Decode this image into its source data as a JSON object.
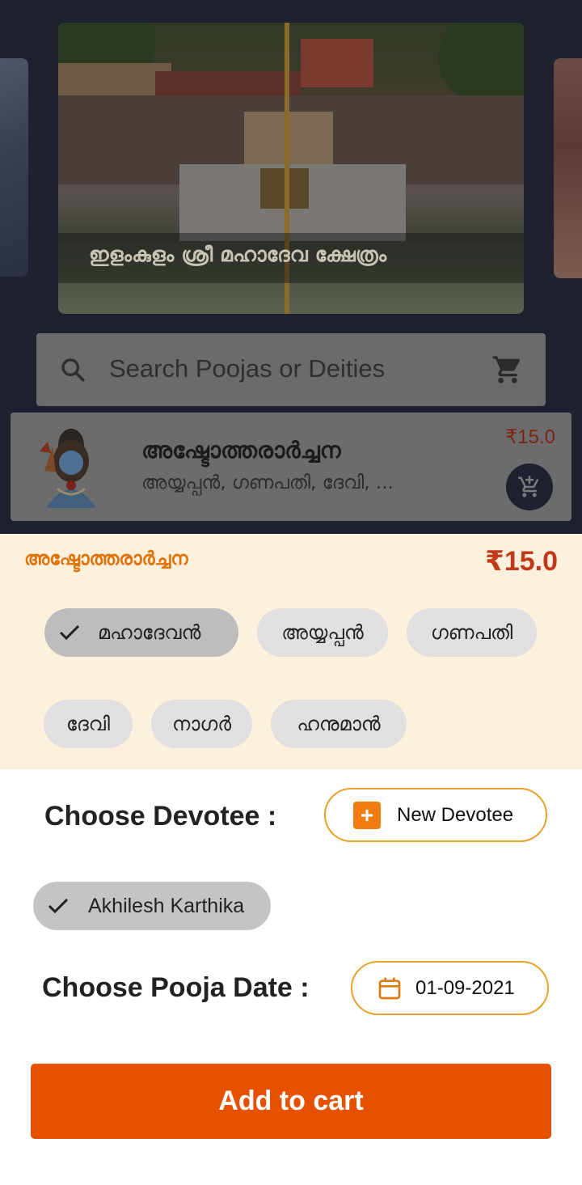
{
  "hero": {
    "caption": "ഇളംകുളം ശ്രീ മഹാദേവ ക്ഷേത്രം"
  },
  "search": {
    "placeholder": "Search Poojas or Deities"
  },
  "pooja_card": {
    "title": "അഷ്ടോത്തരാർച്ചന",
    "subtitle": "അയ്യപ്പൻ, ഗണപതി, ദേവി, ...",
    "price": "₹15.0"
  },
  "sheet": {
    "title": "അഷ്ടോത്തരാർച്ചന",
    "price": "₹15.0",
    "deities": [
      {
        "label": "മഹാദേവൻ",
        "selected": true
      },
      {
        "label": "അയ്യപ്പൻ",
        "selected": false
      },
      {
        "label": "ഗണപതി",
        "selected": false
      },
      {
        "label": "ദേവി",
        "selected": false
      },
      {
        "label": "നാഗർ",
        "selected": false
      },
      {
        "label": "ഹനുമാൻ",
        "selected": false
      }
    ],
    "choose_devotee_label": "Choose Devotee :",
    "new_devotee_label": "New Devotee",
    "devotees": [
      {
        "name": "Akhilesh Karthika",
        "selected": true
      }
    ],
    "choose_date_label": "Choose Pooja Date :",
    "date_value": "01-09-2021",
    "add_to_cart_label": "Add to cart"
  },
  "colors": {
    "accent": "#e65100",
    "price": "#c0391b",
    "sheet_bg": "#fdf0dd",
    "outline": "#e7a32b"
  },
  "icons": [
    "search-icon",
    "cart-icon",
    "add-to-cart-icon",
    "check-icon",
    "plus-icon",
    "calendar-icon"
  ]
}
